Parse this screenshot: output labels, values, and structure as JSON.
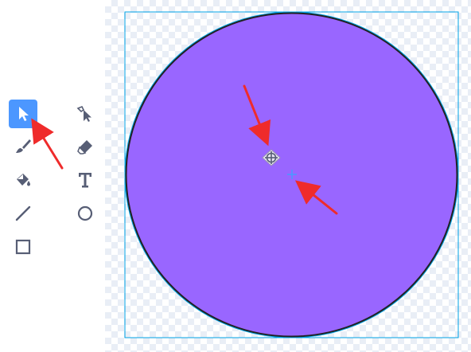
{
  "toolbar": {
    "tools": [
      {
        "name": "select-tool",
        "icon": "arrow-pointer-icon",
        "selected": true
      },
      {
        "name": "reshape-tool",
        "icon": "reshape-pointer-icon",
        "selected": false
      },
      {
        "name": "brush-tool",
        "icon": "brush-icon",
        "selected": false
      },
      {
        "name": "eraser-tool",
        "icon": "eraser-icon",
        "selected": false
      },
      {
        "name": "fill-tool",
        "icon": "paint-bucket-icon",
        "selected": false
      },
      {
        "name": "text-tool",
        "icon": "text-t-icon",
        "selected": false
      },
      {
        "name": "line-tool",
        "icon": "line-icon",
        "selected": false
      },
      {
        "name": "circle-tool",
        "icon": "circle-icon",
        "selected": false
      },
      {
        "name": "rectangle-tool",
        "icon": "square-icon",
        "selected": false
      }
    ]
  },
  "canvas": {
    "shape": "circle",
    "fill_color": "#9966ff",
    "stroke_color": "#222222",
    "selection_color": "#00a3e6"
  },
  "colors": {
    "tool_icon": "#575e75",
    "selected_tool_bg": "#4c97ff",
    "annotation_arrow": "#ef2b2b"
  }
}
